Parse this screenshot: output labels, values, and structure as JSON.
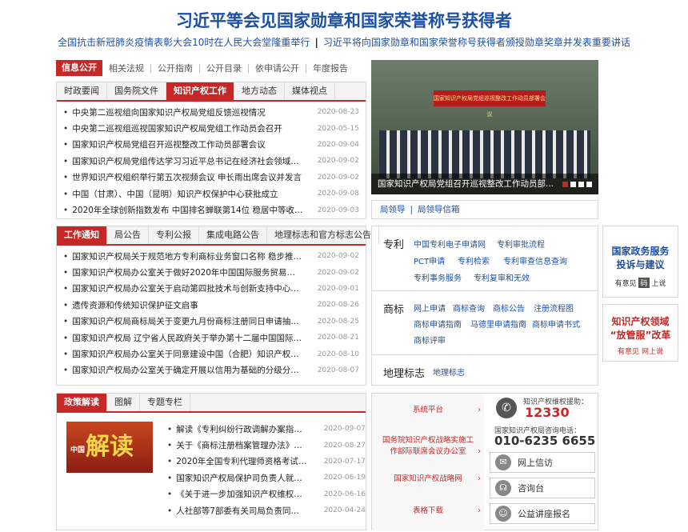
{
  "headline": "习近平等会见国家勋章和国家荣誉称号获得者",
  "subheads": [
    "全国抗击新冠肺炎疫情表彰大会10时在人民大会堂隆重举行",
    "习近平将向国家勋章和国家荣誉称号获得者颁授勋章奖章并发表重要讲话"
  ],
  "subhead_sep": "|",
  "info_bar": {
    "label": "信息公开",
    "links": [
      "相关法规",
      "公开指南",
      "公开目录",
      "依申请公开",
      "年度报告"
    ]
  },
  "news_tabs": [
    "时政要闻",
    "国务院文件",
    "知识产权工作",
    "地方动态",
    "媒体视点"
  ],
  "news_active": 2,
  "news": [
    {
      "title": "中央第二巡视组向国家知识产权局党组反馈巡视情况",
      "date": "2020-08-23"
    },
    {
      "title": "中央第二巡视组巡视国家知识产权局党组工作动员会召开",
      "date": "2020-05-15"
    },
    {
      "title": "国家知识产权局党组召开巡视整改工作动员部署会议",
      "date": "2020-09-04"
    },
    {
      "title": "国家知识产权局党组传达学习习近平总书记在经济社会领域专家...",
      "date": "2020-09-02"
    },
    {
      "title": "世界知识产权组织举行第五次视频会议 申长雨出席会议并发言",
      "date": "2020-09-02"
    },
    {
      "title": "中国（甘肃）、中国（昆明）知识产权保护中心获批成立",
      "date": "2020-09-08"
    },
    {
      "title": "2020年全球创新指数发布 中国排名蝉联第14位 稳居中等收入经...",
      "date": "2020-09-03"
    }
  ],
  "photo": {
    "banner": "国家知识产权局党组巡视整改工作动员部署会议",
    "caption": "国家知识产权局党组召开巡视整改工作动员部..."
  },
  "leaders": [
    "局领导",
    "|",
    "局领导信箱"
  ],
  "notice_tabs": [
    "工作通知",
    "局公告",
    "专利公报",
    "集成电路公告",
    "地理标志和官方标志公告"
  ],
  "notice_active": 0,
  "notices": [
    {
      "title": "国家知识产权局关于规范地方专利商标业务窗口名称 稳步推进知...",
      "date": "2020-09-02"
    },
    {
      "title": "国家知识产权局办公室关于做好2020年中国国际服务贸易交易会...",
      "date": "2020-09-02"
    },
    {
      "title": "国家知识产权局办公室关于启动第四批技术与创新支持中心（TIS...",
      "date": "2020-09-01"
    },
    {
      "title": "遗传资源和传统知识保护征文启事",
      "date": "2020-08-26"
    },
    {
      "title": "国家知识产权局商标局关于变更九月份商标注册同日申请抽签时...",
      "date": "2020-08-25"
    },
    {
      "title": "国家知识产权局 辽宁省人民政府关于举办第十二届中国国际专利...",
      "date": "2020-08-21"
    },
    {
      "title": "国家知识产权局办公室关于同意建设中国（合肥）知识产权保护中...",
      "date": "2020-08-10"
    },
    {
      "title": "国家知识产权局办公室关于确定开展以信用为基础的分级分类监...",
      "date": "2020-08-07"
    }
  ],
  "patent": {
    "title": "专利",
    "rows": [
      [
        "中国专利电子申请网",
        "专利审批流程"
      ],
      [
        "PCT申请",
        "专利检索",
        "专利审查信息查询"
      ],
      [
        "专利事务服务",
        "专利复审和无效"
      ]
    ]
  },
  "trademark": {
    "title": "商标",
    "rows": [
      [
        "网上申请",
        "商标查询",
        "商标公告",
        "注册流程图"
      ],
      [
        "商标申请指南",
        "马德里申请指南",
        "商标申请书式"
      ],
      [
        "商标评审"
      ]
    ]
  },
  "geo": {
    "title": "地理标志",
    "link": "地理标志"
  },
  "side1": {
    "lines": [
      "国家政务服务",
      "投诉与建议"
    ],
    "note": "有意见",
    "tag": "码",
    "action": "上说"
  },
  "side2": {
    "lines": [
      "知识产权领域",
      "“放管服”改革"
    ],
    "note": "有意见",
    "action": "网上说"
  },
  "policy_tabs": [
    "政策解读",
    "图解",
    "专题专栏"
  ],
  "policy_active": 0,
  "policy_image": {
    "glyph": "解读",
    "small": "中国"
  },
  "policy": [
    {
      "title": "解读《专利纠纷行政调解办案指南》...",
      "date": "2020-09-07"
    },
    {
      "title": "关于《商标注册档案管理办法》的制...",
      "date": "2020-08-27"
    },
    {
      "title": "2020年全国专利代理师资格考试常...",
      "date": "2020-07-17"
    },
    {
      "title": "国家知识产权局保护司负责人就《商...",
      "date": "2020-06-19"
    },
    {
      "title": "《关于进一步加强知识产权维权援助...",
      "date": "2020-06-16"
    },
    {
      "title": "人社部等7部委有关司局负责同志就...",
      "date": "2020-04-24"
    }
  ],
  "contact_left": [
    "系统平台",
    "国务院知识产权战略实施工作部际联席会议办公室",
    "国家知识产权战略网",
    "表格下载"
  ],
  "hotline": {
    "label": "知识产权维权援助：",
    "number": "12330"
  },
  "consult": {
    "label": "国家知识产权局咨询电话：",
    "number": "010-6235 6655"
  },
  "contact_right": [
    "网上信访",
    "咨询台",
    "公益讲座报名"
  ],
  "colors": {
    "accent": "#c62828",
    "link": "#1e50a2"
  }
}
